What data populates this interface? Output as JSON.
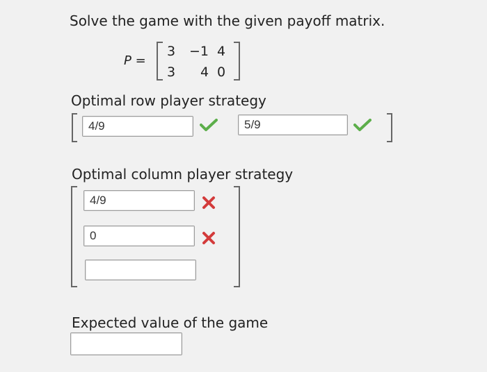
{
  "question": {
    "prompt": "Solve the game with the given payoff matrix."
  },
  "matrix": {
    "label": "P =",
    "rows": [
      [
        "3",
        "−1",
        "4"
      ],
      [
        "3",
        "4",
        "0"
      ]
    ]
  },
  "row_strategy": {
    "heading": "Optimal row player strategy",
    "fields": [
      {
        "value": "4/9",
        "status": "correct"
      },
      {
        "value": "5/9",
        "status": "correct"
      }
    ]
  },
  "column_strategy": {
    "heading": "Optimal column player strategy",
    "fields": [
      {
        "value": "4/9",
        "status": "incorrect"
      },
      {
        "value": "0",
        "status": "incorrect"
      },
      {
        "value": "",
        "status": "none"
      }
    ]
  },
  "expected_value": {
    "heading": "Expected value of the game",
    "value": ""
  },
  "colors": {
    "correct": "#5cae4a",
    "incorrect": "#d33b3b"
  },
  "icons": {
    "correct": "check-icon",
    "incorrect": "x-icon"
  }
}
